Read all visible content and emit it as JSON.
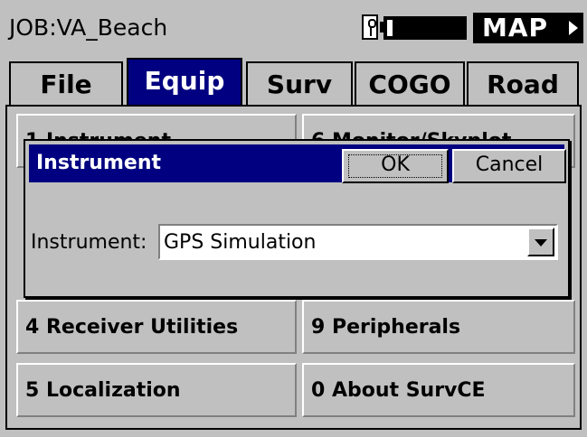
{
  "titlebar": {
    "job_title": "JOB:VA_Beach",
    "map_label": "MAP"
  },
  "tabs": [
    {
      "label": "File"
    },
    {
      "label": "Equip"
    },
    {
      "label": "Surv"
    },
    {
      "label": "COGO"
    },
    {
      "label": "Road"
    }
  ],
  "menu": {
    "items": [
      {
        "label": "1 Instrument"
      },
      {
        "label": "6 Monitor/Skyplot"
      },
      {
        "label": "4 Receiver Utilities"
      },
      {
        "label": "9 Peripherals"
      },
      {
        "label": "5 Localization"
      },
      {
        "label": "0 About SurvCE"
      }
    ]
  },
  "dialog": {
    "title": "Instrument",
    "ok_label": "OK",
    "cancel_label": "Cancel",
    "field_label": "Instrument:",
    "field_value": "GPS Simulation"
  },
  "colors": {
    "window_bg": "#c0c0c0",
    "active_blue": "#000080",
    "title_text": "#ffffff"
  },
  "icons": [
    "gps-status-icon",
    "battery-icon",
    "chevron-right-icon",
    "dropdown-arrow-icon"
  ]
}
